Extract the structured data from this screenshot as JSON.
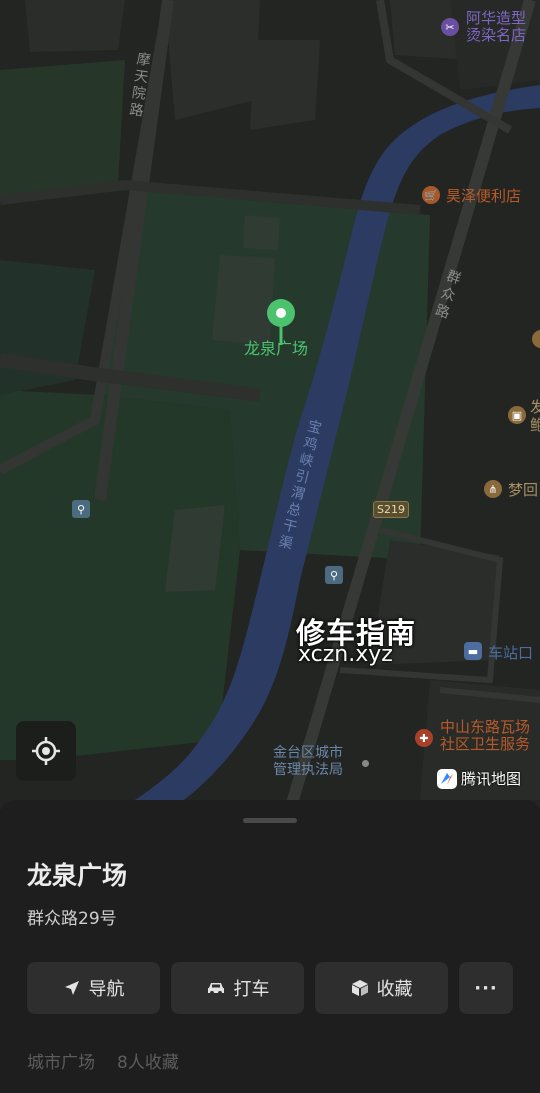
{
  "map": {
    "pin_label": "龙泉广场",
    "roads": {
      "motian_road": [
        "摩",
        "天",
        "院",
        "路"
      ],
      "qunzhong_road": [
        "群",
        "众",
        "路"
      ],
      "canal": [
        "宝",
        "鸡",
        "峡",
        "引",
        "渭",
        "总",
        "干",
        "渠"
      ],
      "route_badge": "S219"
    },
    "pois": {
      "ahua_line1": "阿华造型",
      "ahua_line2": "烫染名店",
      "haoze": "昊泽便利店",
      "menghui": "梦回",
      "bus_station": "车站口",
      "zhongshan_line1": "中山东路瓦场",
      "zhongshan_line2": "社区卫生服务",
      "jintai_line1": "金台区城市",
      "jintai_line2": "管理执法局",
      "edge_char": "发",
      "edge_char2": "鲍"
    },
    "brand": "腾讯地图",
    "watermark_title": "修车指南",
    "watermark_url": "xczn.xyz"
  },
  "place": {
    "name": "龙泉广场",
    "address": "群众路29号",
    "category": "城市广场",
    "favorites_count": "8人收藏"
  },
  "actions": {
    "navigate": "导航",
    "taxi": "打车",
    "favorite": "收藏",
    "more": "···"
  },
  "colors": {
    "map_bg": "#222522",
    "park": "#24352a",
    "water": "#2a3960",
    "poi_orange": "#b85a2a",
    "pin_green": "#4cc26e"
  }
}
